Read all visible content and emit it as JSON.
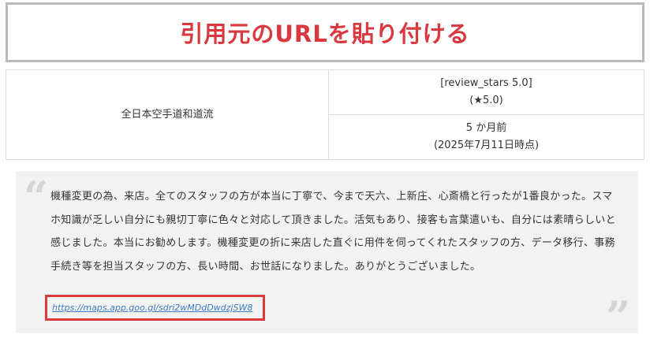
{
  "header": {
    "title": "引用元のURLを貼り付ける"
  },
  "review": {
    "store_name": "全日本空手道和道流",
    "stars_shortcode": "[review_stars 5.0]",
    "stars_value": "(★5.0)",
    "relative_time": "5 か月前",
    "as_of_date": "(2025年7月11日時点)"
  },
  "quote": {
    "open_mark": "“",
    "close_mark": "”",
    "body": "機種変更の為、来店。全てのスタッフの方が本当に丁寧で、今まで天六、上新庄、心斎橋と行ったが1番良かった。スマホ知識が乏しい自分にも親切丁寧に色々と対応して頂きました。活気もあり、接客も言葉遣いも、自分には素晴らしいと感じました。本当にお勧めします。機種変更の折に来店した直ぐに用件を伺ってくれたスタッフの方、データ移行、事務手続き等を担当スタッフの方、長い時間、お世話になりました。ありがとうございました。",
    "link": "https://maps.app.goo.gl/sdri2wMDdDwdzjSW8"
  },
  "colors": {
    "title_red": "#d8383e",
    "highlight_red": "#d93a3a",
    "link_blue": "#3b7cc4",
    "quote_bg": "#f2f2f2"
  }
}
